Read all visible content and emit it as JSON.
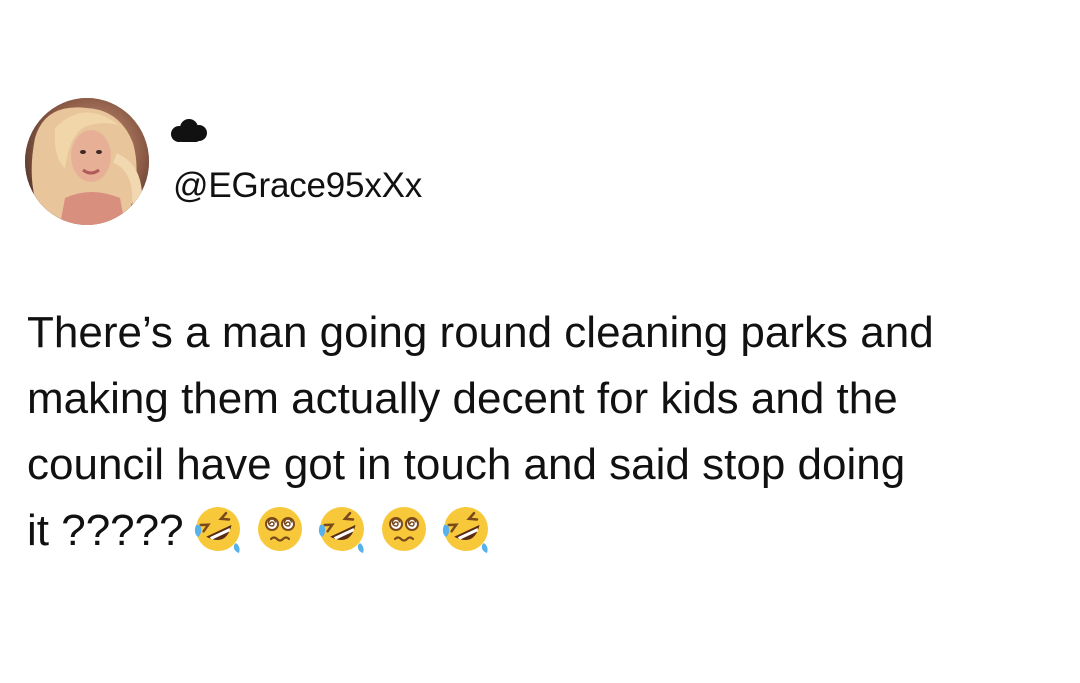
{
  "tweet": {
    "display_name_icon": "black-cloud-icon",
    "handle": "@EGrace95xXx",
    "avatar_icon": "profile-photo",
    "text_lines": [
      "There’s a man going round cleaning parks and",
      "making them actually decent for kids and the",
      "council have got in touch and said stop doing",
      "it ?????"
    ],
    "emojis": [
      "rolling-on-the-floor-laughing-emoji",
      "face-with-spiral-eyes-emoji",
      "rolling-on-the-floor-laughing-emoji",
      "face-with-spiral-eyes-emoji",
      "rolling-on-the-floor-laughing-emoji"
    ]
  },
  "colors": {
    "background": "#ffffff",
    "text": "#111111",
    "emoji_yellow": "#f7c93a",
    "emoji_tear_blue": "#57b2ec"
  }
}
